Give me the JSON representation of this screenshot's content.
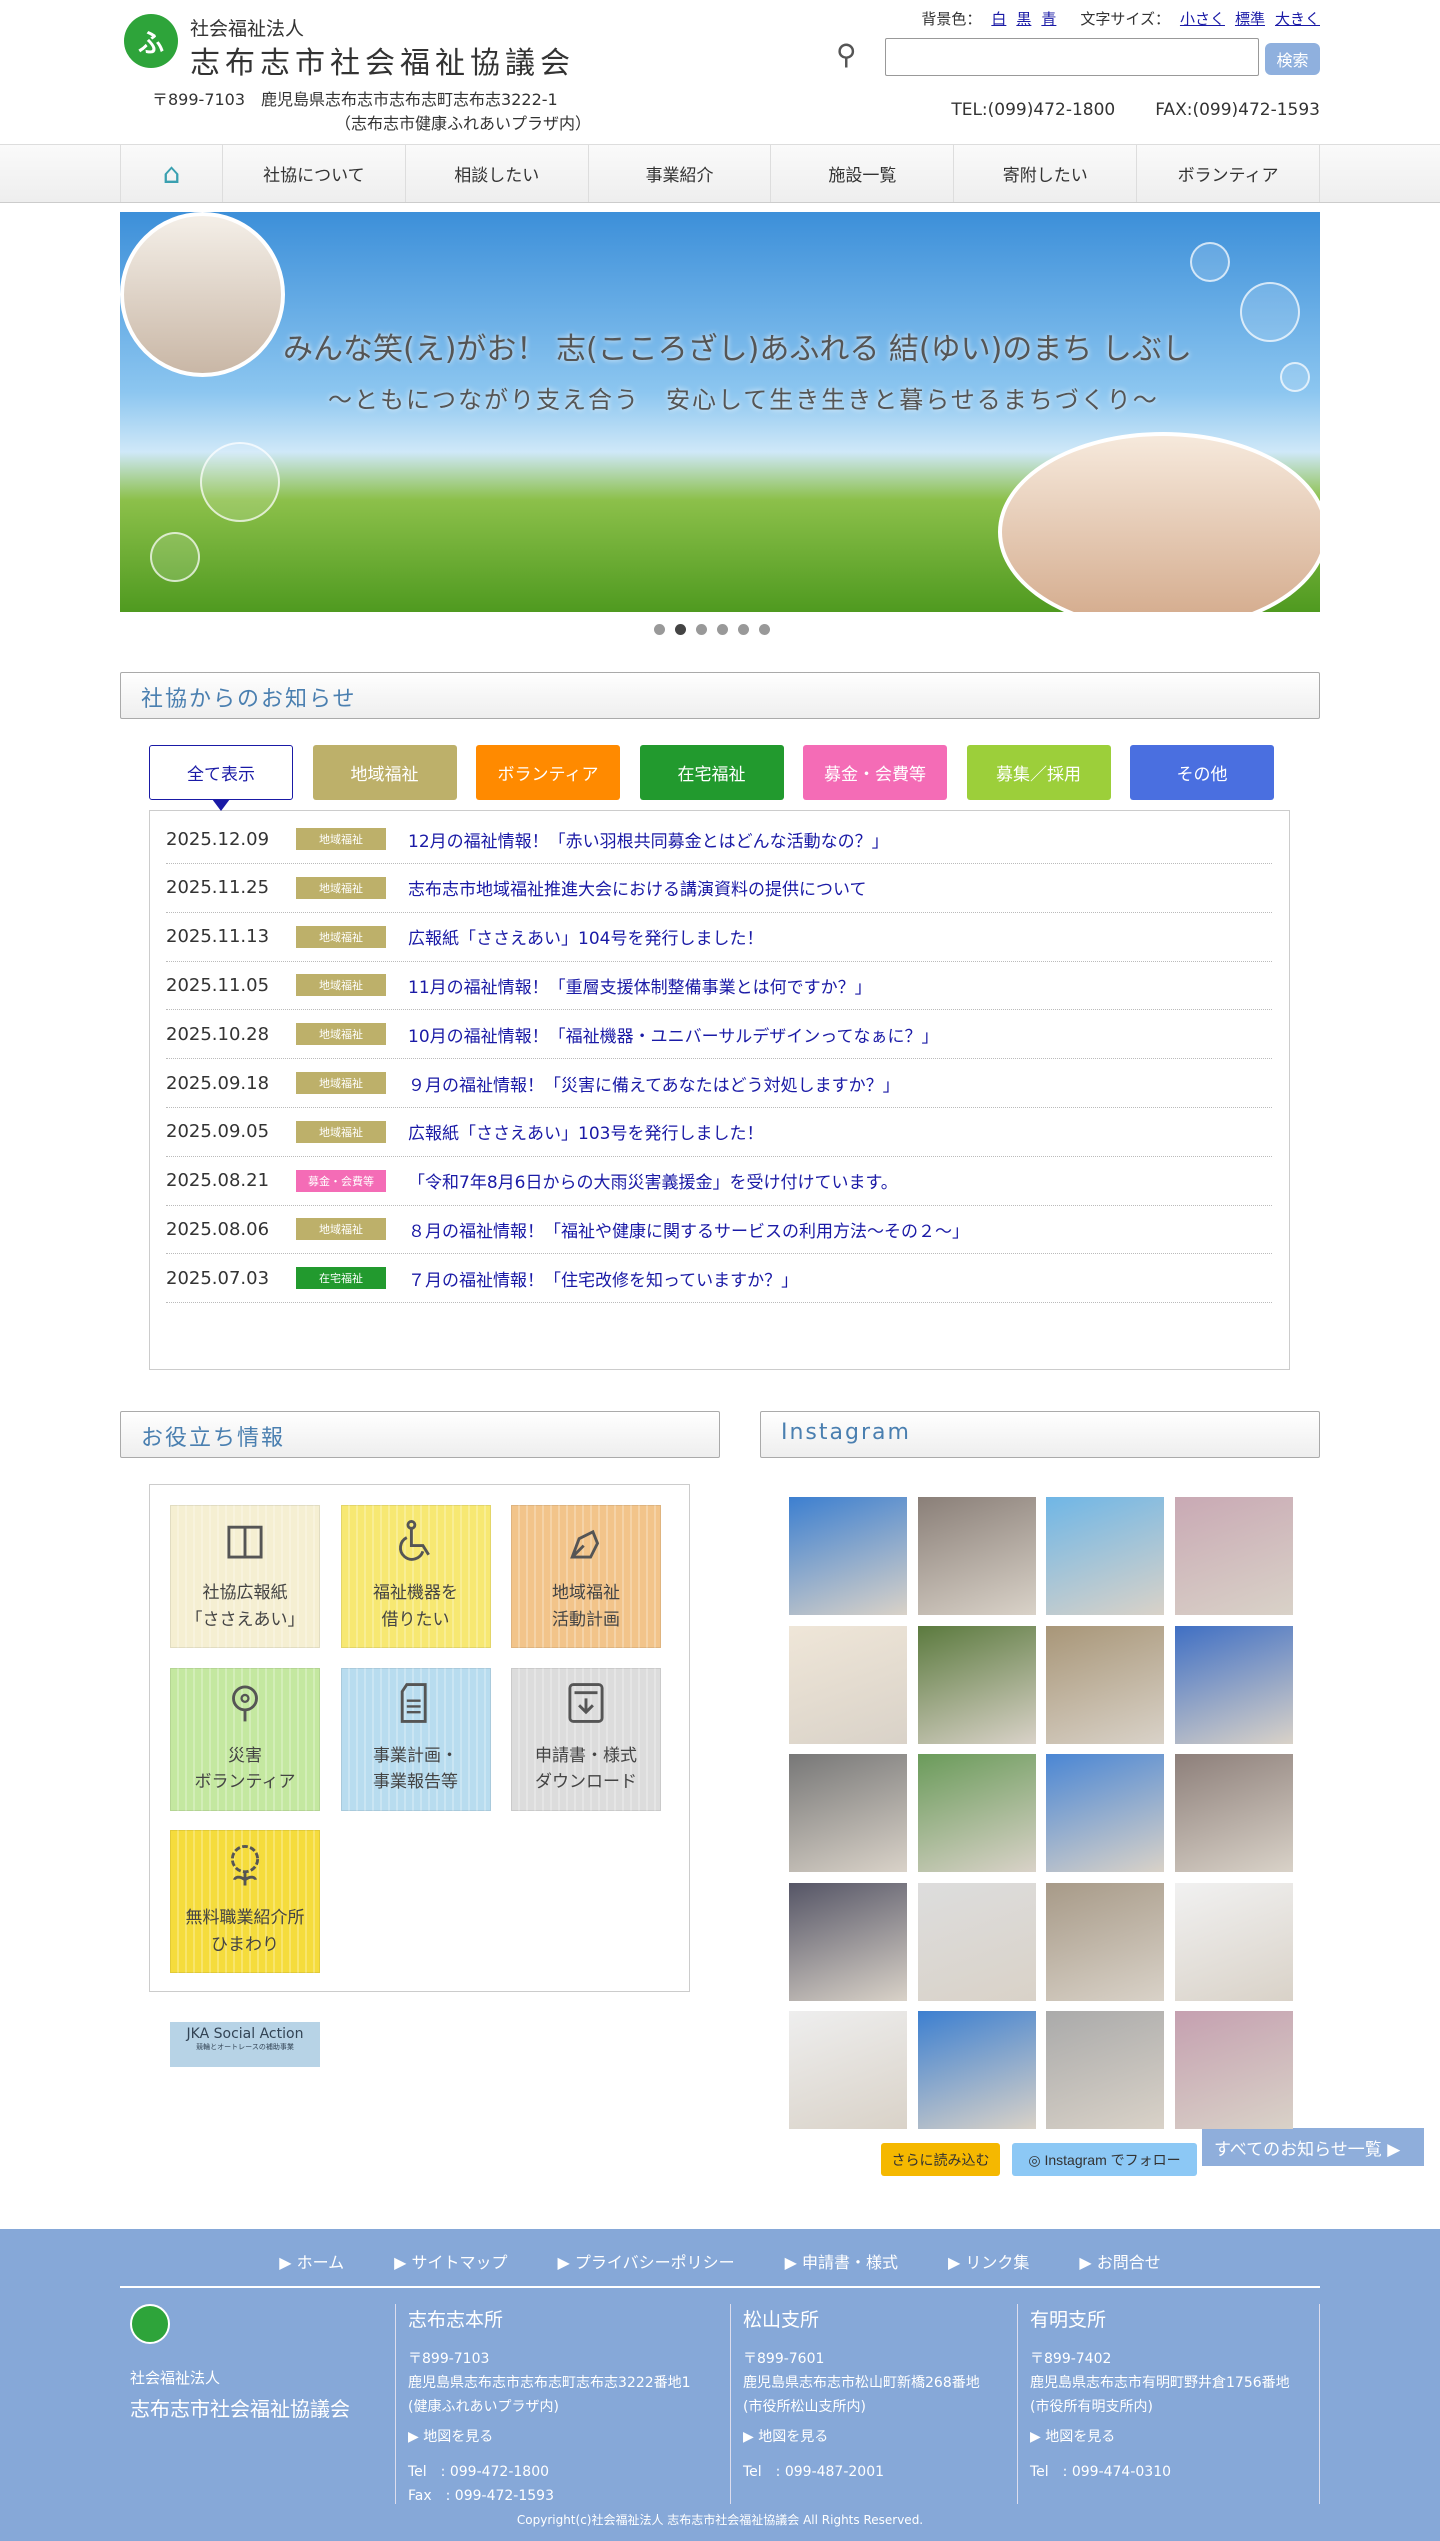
{
  "header": {
    "logo_text": "ふ",
    "org_type": "社会福祉法人",
    "org_name": "志布志市社会福祉協議会",
    "address1": "〒899-7103　鹿児島県志布志市志布志町志布志3222-1",
    "address2": "（志布志市健康ふれあいプラザ内）",
    "bg_label": "背景色：",
    "bg_options": [
      "白",
      "黒",
      "青"
    ],
    "size_label": "文字サイズ：",
    "size_options": [
      "小さく",
      "標準",
      "大きく"
    ],
    "search_placeholder": "",
    "search_button": "検索",
    "tel": "TEL:(099)472-1800",
    "fax": "FAX:(099)472-1593"
  },
  "nav": {
    "home_icon": "⌂",
    "items": [
      "社協について",
      "相談したい",
      "事業紹介",
      "施設一覧",
      "寄附したい",
      "ボランティア"
    ]
  },
  "hero": {
    "title": "みんな笑(え)がお！ 志(こころざし)あふれる 結(ゆい)のまち しぶし",
    "subtitle": "〜ともにつながり支え合う　安心して生き生きと暮らせるまちづくり〜",
    "slide_count": 6,
    "active_slide": 2
  },
  "news": {
    "heading": "社協からのお知らせ",
    "tabs": [
      {
        "label": "全て表示",
        "color": "#ffffff"
      },
      {
        "label": "地域福祉",
        "color": "#bdb06a"
      },
      {
        "label": "ボランティア",
        "color": "#ff8a00"
      },
      {
        "label": "在宅福祉",
        "color": "#229a2e"
      },
      {
        "label": "募金・会費等",
        "color": "#f46cb6"
      },
      {
        "label": "募集／採用",
        "color": "#9ccf3a"
      },
      {
        "label": "その他",
        "color": "#4a6fe0"
      }
    ],
    "items": [
      {
        "date": "2025.12.09",
        "cat": "地域福祉",
        "color": "#bdb06a",
        "title": "12月の福祉情報！「赤い羽根共同募金とはどんな活動なの？」"
      },
      {
        "date": "2025.11.25",
        "cat": "地域福祉",
        "color": "#bdb06a",
        "title": "志布志市地域福祉推進大会における講演資料の提供について"
      },
      {
        "date": "2025.11.13",
        "cat": "地域福祉",
        "color": "#bdb06a",
        "title": "広報紙「ささえあい」104号を発行しました！"
      },
      {
        "date": "2025.11.05",
        "cat": "地域福祉",
        "color": "#bdb06a",
        "title": "11月の福祉情報！「重層支援体制整備事業とは何ですか？」"
      },
      {
        "date": "2025.10.28",
        "cat": "地域福祉",
        "color": "#bdb06a",
        "title": "10月の福祉情報！「福祉機器・ユニバーサルデザインってなぁに？」"
      },
      {
        "date": "2025.09.18",
        "cat": "地域福祉",
        "color": "#bdb06a",
        "title": "９月の福祉情報！「災害に備えてあなたはどう対処しますか？」"
      },
      {
        "date": "2025.09.05",
        "cat": "地域福祉",
        "color": "#bdb06a",
        "title": "広報紙「ささえあい」103号を発行しました！"
      },
      {
        "date": "2025.08.21",
        "cat": "募金・会費等",
        "color": "#f46cb6",
        "title": "「令和7年8月6日からの大雨災害義援金」を受け付けています。"
      },
      {
        "date": "2025.08.06",
        "cat": "地域福祉",
        "color": "#bdb06a",
        "title": "８月の福祉情報！「福祉や健康に関するサービスの利用方法〜その２〜」"
      },
      {
        "date": "2025.07.03",
        "cat": "在宅福祉",
        "color": "#229a2e",
        "title": "７月の福祉情報！「住宅改修を知っていますか？」"
      }
    ],
    "all_link": "すべてのお知らせ一覧 ▶"
  },
  "useful": {
    "heading": "お役立ち情報",
    "tiles": [
      {
        "line1": "社協広報紙",
        "line2": "「ささえあい」",
        "icon": "book-icon",
        "color": "#f5efd2"
      },
      {
        "line1": "福祉機器を",
        "line2": "借りたい",
        "icon": "wheelchair-icon",
        "color": "#f7e872"
      },
      {
        "line1": "地域福祉",
        "line2": "活動計画",
        "icon": "pen-icon",
        "color": "#f2c48a"
      },
      {
        "line1": "災害",
        "line2": "ボランティア",
        "icon": "flower-icon",
        "color": "#c4e8a0"
      },
      {
        "line1": "事業計画・",
        "line2": "事業報告等",
        "icon": "document-icon",
        "color": "#b8dcef"
      },
      {
        "line1": "申請書・様式",
        "line2": "ダウンロード",
        "icon": "download-icon",
        "color": "#dcdcdc"
      },
      {
        "line1": "無料職業紹介所",
        "line2": "ひまわり",
        "icon": "sunflower-icon",
        "color": "#f5dc3c"
      }
    ],
    "jka_title": "JKA Social Action",
    "jka_sub": "競輪とオートレースの補助事業"
  },
  "instagram": {
    "heading": "Instagram",
    "load_more": "さらに読み込む",
    "follow": "Instagram でフォロー",
    "post_count": 20
  },
  "footer": {
    "links": [
      "ホーム",
      "サイトマップ",
      "プライバシーポリシー",
      "申請書・様式",
      "リンク集",
      "お問合せ"
    ],
    "org_type": "社会福祉法人",
    "org_name": "志布志市社会福祉協議会",
    "offices": [
      {
        "name": "志布志本所",
        "zip": "〒899-7103",
        "addr": "鹿児島県志布志市志布志町志布志3222番地1",
        "note": "(健康ふれあいプラザ内)",
        "map": "▶ 地図を見る",
        "tel": "Tel　: 099-472-1800",
        "fax": "Fax　: 099-472-1593"
      },
      {
        "name": "松山支所",
        "zip": "〒899-7601",
        "addr": "鹿児島県志布志市松山町新橋268番地",
        "note": "(市役所松山支所内)",
        "map": "▶ 地図を見る",
        "tel": "Tel　: 099-487-2001"
      },
      {
        "name": "有明支所",
        "zip": "〒899-7402",
        "addr": "鹿児島県志布志市有明町野井倉1756番地",
        "note": "(市役所有明支所内)",
        "map": "▶ 地図を見る",
        "tel": "Tel　: 099-474-0310"
      }
    ],
    "copyright": "Copyright(c)社会福祉法人 志布志市社会福祉協議会 All Rights Reserved."
  }
}
